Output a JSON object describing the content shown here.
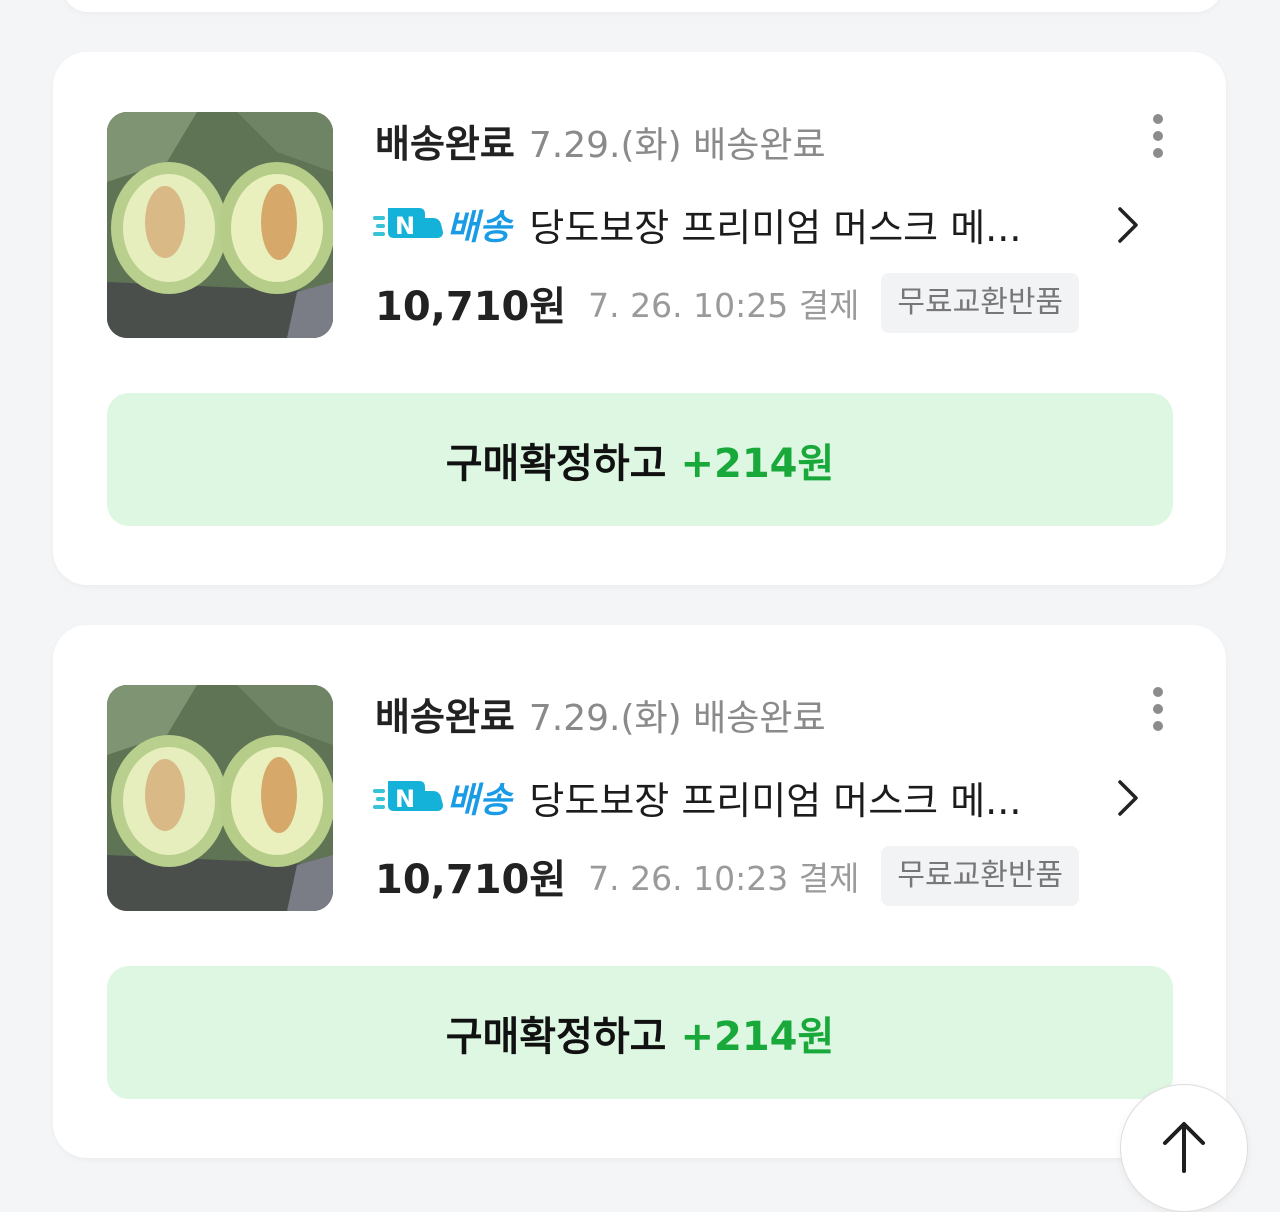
{
  "orders": [
    {
      "status": "배송완료",
      "status_detail": "7.29.(화) 배송완료",
      "delivery_label": "배송",
      "product_name": "당도보장 프리미엄 머스크 메...",
      "price": "10,710원",
      "paid_at": "7. 26. 10:25 결제",
      "badge": "무료교환반품",
      "confirm_label": "구매확정하고",
      "confirm_reward": "+214원"
    },
    {
      "status": "배송완료",
      "status_detail": "7.29.(화) 배송완료",
      "delivery_label": "배송",
      "product_name": "당도보장 프리미엄 머스크 메...",
      "price": "10,710원",
      "paid_at": "7. 26. 10:23 결제",
      "badge": "무료교환반품",
      "confirm_label": "구매확정하고",
      "confirm_reward": "+214원"
    }
  ],
  "icons": {
    "delivery": "truck-n-icon",
    "more": "more-vertical-icon",
    "open": "chevron-right-icon",
    "scroll_top": "arrow-up-icon"
  },
  "colors": {
    "delivery_blue": "#1a9be6",
    "confirm_bg": "#ddf7e3",
    "reward_green": "#19a83a"
  }
}
